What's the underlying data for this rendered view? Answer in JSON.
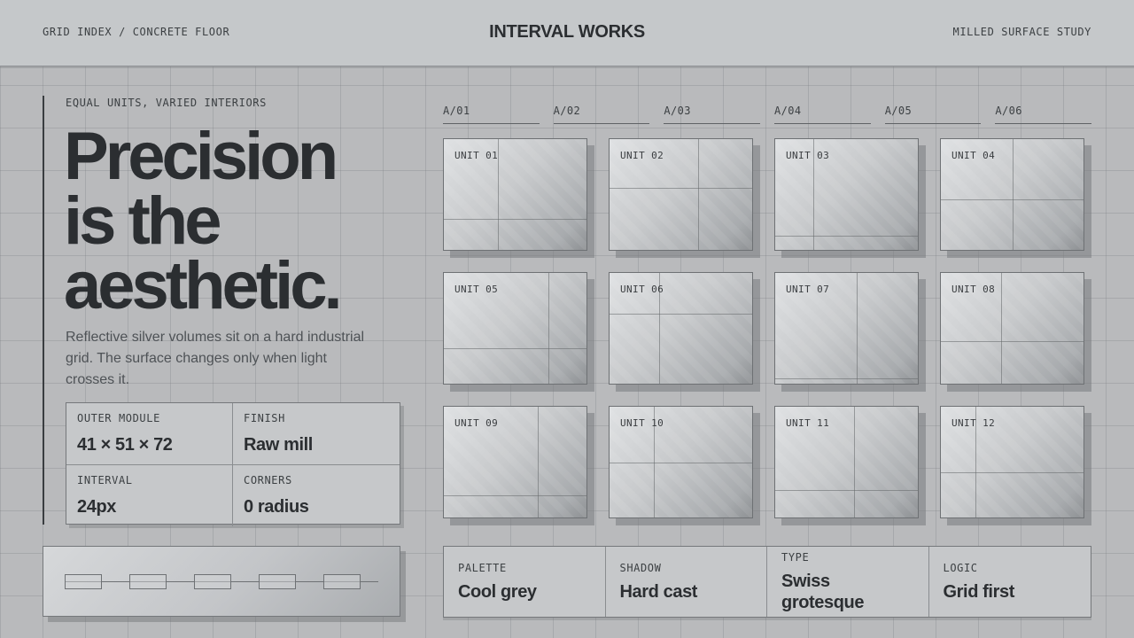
{
  "header": {
    "left": "GRID INDEX / CONCRETE FLOOR",
    "brand": "INTERVAL WORKS",
    "right": "MILLED SURFACE STUDY"
  },
  "hero": {
    "eyebrow": "EQUAL UNITS, VARIED INTERIORS",
    "headline": [
      "Precision",
      "is the",
      "aesthetic."
    ],
    "lede": "Reflective silver volumes sit on a hard industrial grid. The surface changes only when light crosses it."
  },
  "spec": [
    {
      "label": "OUTER MODULE",
      "value": "41 × 51 × 72"
    },
    {
      "label": "FINISH",
      "value": "Raw mill"
    },
    {
      "label": "INTERVAL",
      "value": "24px"
    },
    {
      "label": "CORNERS",
      "value": "0 radius"
    }
  ],
  "columns": [
    "A/01",
    "A/02",
    "A/03",
    "A/04",
    "A/05",
    "A/06"
  ],
  "units": [
    {
      "label": "UNIT 01"
    },
    {
      "label": "UNIT 02"
    },
    {
      "label": "UNIT 03"
    },
    {
      "label": "UNIT 04"
    },
    {
      "label": "UNIT 05"
    },
    {
      "label": "UNIT 06"
    },
    {
      "label": "UNIT 07"
    },
    {
      "label": "UNIT 08"
    },
    {
      "label": "UNIT 09"
    },
    {
      "label": "UNIT 10"
    },
    {
      "label": "UNIT 11"
    },
    {
      "label": "UNIT 12"
    }
  ],
  "attributes": [
    {
      "label": "PALETTE",
      "value": "Cool grey"
    },
    {
      "label": "SHADOW",
      "value": "Hard cast"
    },
    {
      "label": "TYPE",
      "value": "Swiss grotesque"
    },
    {
      "label": "LOGIC",
      "value": "Grid first"
    }
  ]
}
